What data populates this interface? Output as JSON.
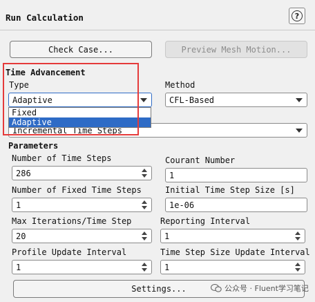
{
  "dialog": {
    "title": "Run Calculation"
  },
  "help": {
    "icon": "?"
  },
  "buttons": {
    "check_case": "Check Case...",
    "preview_mesh_motion": "Preview Mesh Motion...",
    "settings": "Settings..."
  },
  "time_advancement": {
    "section_title": "Time Advancement",
    "type_label": "Type",
    "type_value": "Adaptive",
    "type_options": [
      "Fixed",
      "Adaptive"
    ],
    "method_label": "Method",
    "method_value": "CFL-Based",
    "incremental_value": "Incremental Time Steps"
  },
  "parameters": {
    "section_title": "Parameters",
    "num_time_steps_label": "Number of Time Steps",
    "num_time_steps_value": "286",
    "courant_label": "Courant Number",
    "courant_value": "1",
    "num_fixed_steps_label": "Number of Fixed Time Steps",
    "num_fixed_steps_value": "1",
    "initial_step_label": "Initial Time Step Size [s]",
    "initial_step_value": "1e-06",
    "max_iter_label": "Max Iterations/Time Step",
    "max_iter_value": "20",
    "reporting_label": "Reporting Interval",
    "reporting_value": "1",
    "profile_label": "Profile Update Interval",
    "profile_value": "1",
    "step_size_update_label": "Time Step Size Update Interval",
    "step_size_update_value": "1"
  },
  "watermark": {
    "text": "公众号 · Fluent学习笔记"
  },
  "colors": {
    "highlight": "#e53a3a",
    "selection": "#2e6bc6"
  }
}
